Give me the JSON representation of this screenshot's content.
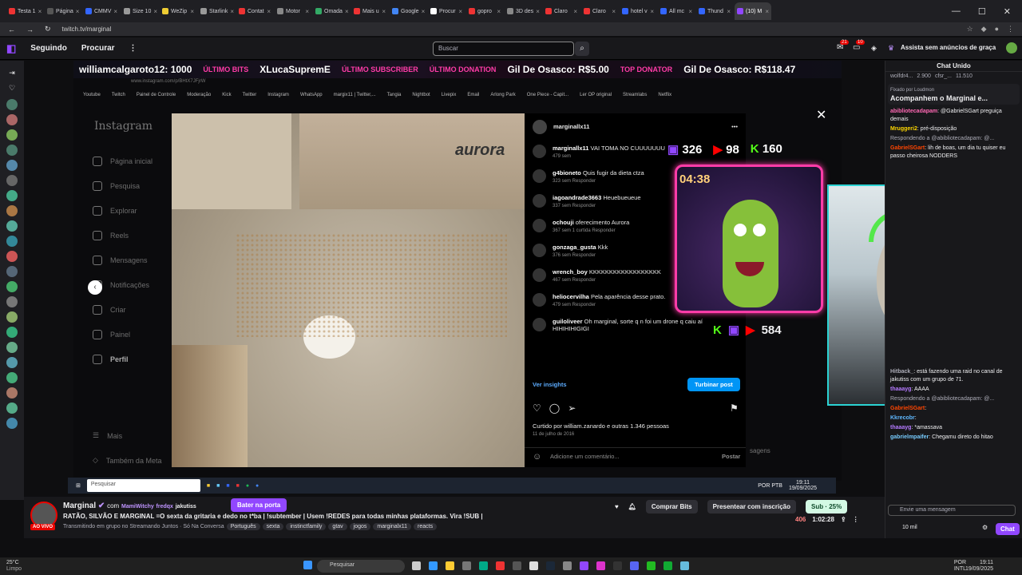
{
  "browser": {
    "tabs": [
      {
        "label": "Testa 1",
        "color": "#e33"
      },
      {
        "label": "Página",
        "color": "#555"
      },
      {
        "label": "CMMV",
        "color": "#36f"
      },
      {
        "label": "Size 10",
        "color": "#999"
      },
      {
        "label": "WeZip",
        "color": "#ec3"
      },
      {
        "label": "Starlink",
        "color": "#999"
      },
      {
        "label": "Contat",
        "color": "#e33"
      },
      {
        "label": "Motor",
        "color": "#888"
      },
      {
        "label": "Omada",
        "color": "#3a6"
      },
      {
        "label": "Mais u",
        "color": "#e33"
      },
      {
        "label": "Google",
        "color": "#4285f4"
      },
      {
        "label": "Procur",
        "color": "#fff"
      },
      {
        "label": "gopro",
        "color": "#e33"
      },
      {
        "label": "3D des",
        "color": "#888"
      },
      {
        "label": "Claro",
        "color": "#e33"
      },
      {
        "label": "Claro",
        "color": "#e33"
      },
      {
        "label": "hotel v",
        "color": "#36f"
      },
      {
        "label": "All mc",
        "color": "#36f"
      },
      {
        "label": "Thund",
        "color": "#36f"
      },
      {
        "label": "(10) M",
        "color": "#9147ff"
      }
    ],
    "url": "twitch.tv/marginal",
    "win_min": "—",
    "win_max": "☐",
    "win_close": "✕"
  },
  "twitch": {
    "nav": {
      "following": "Seguindo",
      "browse": "Procurar",
      "more": "⋮"
    },
    "search_placeholder": "Buscar",
    "notif_count_1": "21",
    "notif_count_2": "10",
    "adfree": "Assista sem anúncios de graça"
  },
  "ticker": {
    "items": [
      "williamcalgaroto12: 1000",
      "ÚLTIMO BITS",
      "XLucaSupremE",
      "ÚLTIMO SUBSCRIBER",
      "ÚLTIMO DONATION",
      "Gil De Osasco: R$5.00",
      "TOP DONATOR",
      "Gil De Osasco: R$118.47"
    ]
  },
  "bookmarks": [
    "Youtube",
    "Twitch",
    "Painel de Controle",
    "Moderação",
    "Kick",
    "Twitter",
    "Instagram",
    "WhatsApp",
    "margix11 | Twitter,...",
    "Tangia",
    "Nightbot",
    "Livepix",
    "Email",
    "Arlong Park",
    "One Piece - Capit...",
    "Ler OP original",
    "Streamlabs",
    "Netflix"
  ],
  "ig_url": "www.instagram.com/p/BHtX7JFjrW",
  "instagram": {
    "logo": "Instagram",
    "nav": [
      "Página inicial",
      "Pesquisa",
      "Explorar",
      "Reels",
      "Mensagens",
      "Notificações",
      "Criar",
      "Painel",
      "Perfil"
    ],
    "more": "Mais",
    "meta": "Também da Meta",
    "box_text": "aurora",
    "post_user": "marginallx11",
    "comments": [
      {
        "user": "marginallx11",
        "text": "VAI TOMA NO CUUUUUUU",
        "meta": "479 sem"
      },
      {
        "user": "g4bioneto",
        "text": "Quis fugir da dieta ctza",
        "meta": "323 sem   Responder"
      },
      {
        "user": "iagoandrade3663",
        "text": "Heuebueueue",
        "meta": "337 sem   Responder"
      },
      {
        "user": "ochouji",
        "text": "oferecimento Aurora",
        "meta": "367 sem   1 curtida   Responder"
      },
      {
        "user": "gonzaga_gusta",
        "text": "Kkk",
        "meta": "376 sem   Responder"
      },
      {
        "user": "wrench_boy",
        "text": "KKKKKKKKKKKKKKKKKK",
        "meta": "467 sem   Responder"
      },
      {
        "user": "heliocervilha",
        "text": "Pela aparência desse prato.",
        "meta": "479 sem   Responder"
      },
      {
        "user": "guiloliveer",
        "text": "Oh marginal, sorte q n foi um drone q caiu aí HIHIHIHIGIGI",
        "meta": ""
      }
    ],
    "insights": "Ver insights",
    "boost": "Turbinar post",
    "likes": "Curtido por william.zanardo e outras 1.346 pessoas",
    "date": "11 de julho de 2016",
    "add_comment": "Adicione um comentário...",
    "post": "Postar",
    "msgs": "sagens"
  },
  "overlay": {
    "twitch_count": "326",
    "yt_count": "98",
    "kick_count": "160",
    "timer": "04:38",
    "total": "584"
  },
  "inner_taskbar": {
    "search": "Pesquisar",
    "lang": "POR PTB",
    "time": "19:11",
    "date": "19/09/2025"
  },
  "channel": {
    "live": "AO VIVO",
    "name": "Marginal",
    "with": "com",
    "collabs": [
      "MamiWitchy",
      "fredqx",
      "jakutiss"
    ],
    "follow": "Bater na porta",
    "title": "RATÃO, SILVÃO E MARGINAL =O sexta da gritaria e dedo no t*ba | !subtember | Usem !REDES para todas minhas plataformas. Vira !SUB |",
    "subtitle": "Transmitindo em grupo no Streamando Juntos · Só Na Conversa",
    "tags": [
      "Português",
      "sexta",
      "instinctfamily",
      "gtav",
      "jogos",
      "marginalx11",
      "reacts"
    ],
    "buy_bits": "Comprar Bits",
    "gift": "Presentear com inscrição",
    "sub": "Sub · 25%",
    "viewers": "406",
    "uptime": "1:02:28"
  },
  "chat": {
    "header": "Chat Unido",
    "top_users": [
      "wolfdr4...",
      "2.900",
      "cfsr_...",
      "11.510"
    ],
    "pinned_by": "Fixado por Loudmon",
    "pinned": "Acompanhem o Marginal e...",
    "lines": [
      {
        "user": "abibliotecadapam",
        "color": "#ff69b4",
        "text": "@GabrielSGart preguiça demais"
      },
      {
        "user": "Mruggeri2",
        "color": "#ffd700",
        "text": "pré-disposição"
      },
      {
        "user": "",
        "color": "#adadb8",
        "text": "Respondendo a @abibliotecadapam: @..."
      },
      {
        "user": "GabrielSGart",
        "color": "#ff4500",
        "text": "lih de boas, um dia tu quiser eu passo cheirosa NODDERS"
      },
      {
        "user": "Hitback_",
        "color": "#adadb8",
        "text": "está fazendo uma raid no canal de jakutiss com um grupo de 71."
      },
      {
        "user": "thaaayg",
        "color": "#b57aff",
        "text": "AAAA"
      },
      {
        "user": "",
        "color": "#adadb8",
        "text": "Respondendo a @abibliotecadapam: @..."
      },
      {
        "user": "GabrielSGart",
        "color": "#ff4500",
        "text": ""
      },
      {
        "user": "Kkrecobr",
        "color": "#5fb8ff",
        "text": ""
      },
      {
        "user": "thaaayg",
        "color": "#b57aff",
        "text": "*amassava"
      },
      {
        "user": "gabrielmpaifer",
        "color": "#7cf",
        "text": "Chegamu direto do hitao"
      }
    ],
    "input_placeholder": "Envie uma mensagem",
    "points": "10 mil",
    "send": "Chat"
  },
  "windows": {
    "temp": "25°C",
    "weather": "Limpo",
    "search": "Pesquisar",
    "lang1": "POR",
    "lang2": "INTL",
    "time": "19:11",
    "date": "19/09/2025"
  }
}
